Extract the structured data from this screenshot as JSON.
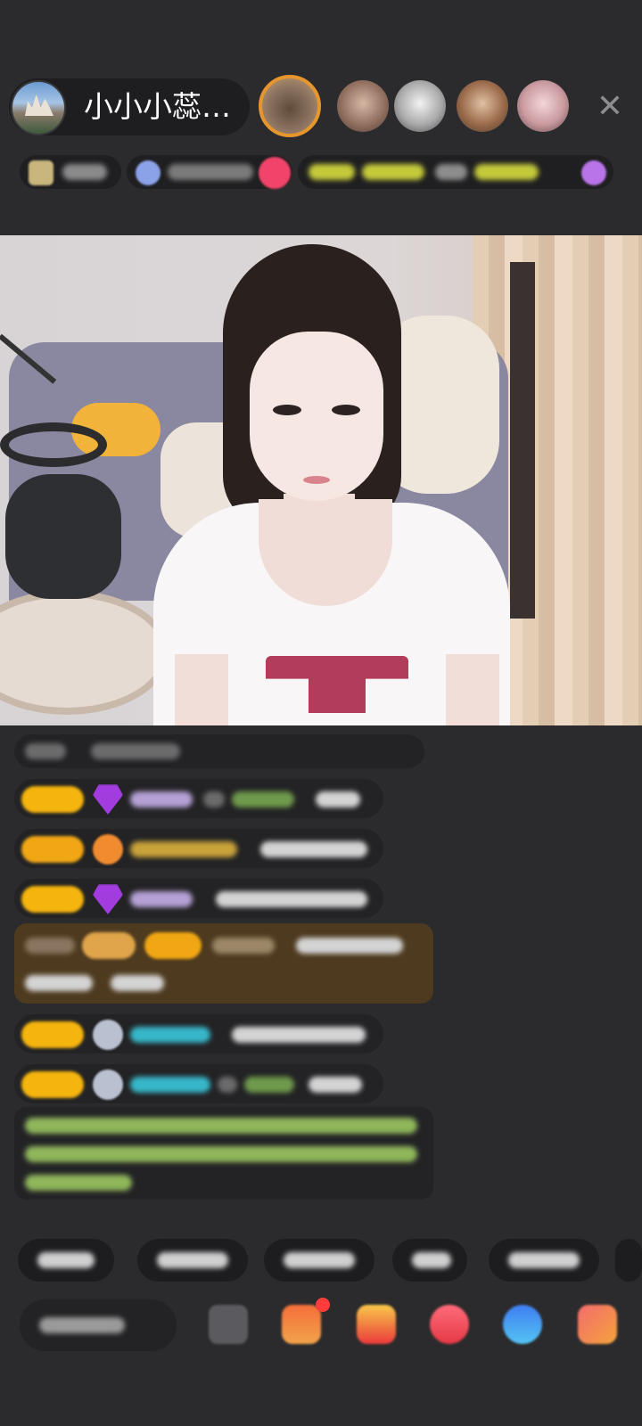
{
  "header": {
    "host_name": "小小小蕊…",
    "close_icon": "close-icon"
  },
  "viewers": [
    {
      "name": "top-viewer-1"
    },
    {
      "name": "top-viewer-2"
    },
    {
      "name": "top-viewer-3"
    },
    {
      "name": "top-viewer-4"
    },
    {
      "name": "top-viewer-5"
    }
  ],
  "colors": {
    "background": "#2b2b2d",
    "badge": "#f5b40e",
    "system_message": "#4e3a1f",
    "accent_red": "#ff3b3b"
  },
  "icons": {
    "input": "chat-input",
    "share": "share-icon",
    "gift_box": "gift-box-icon",
    "red_packet": "red-packet-icon",
    "heart": "heart-icon",
    "chat_bubble": "chat-bubble-icon",
    "gift": "gift-icon"
  }
}
